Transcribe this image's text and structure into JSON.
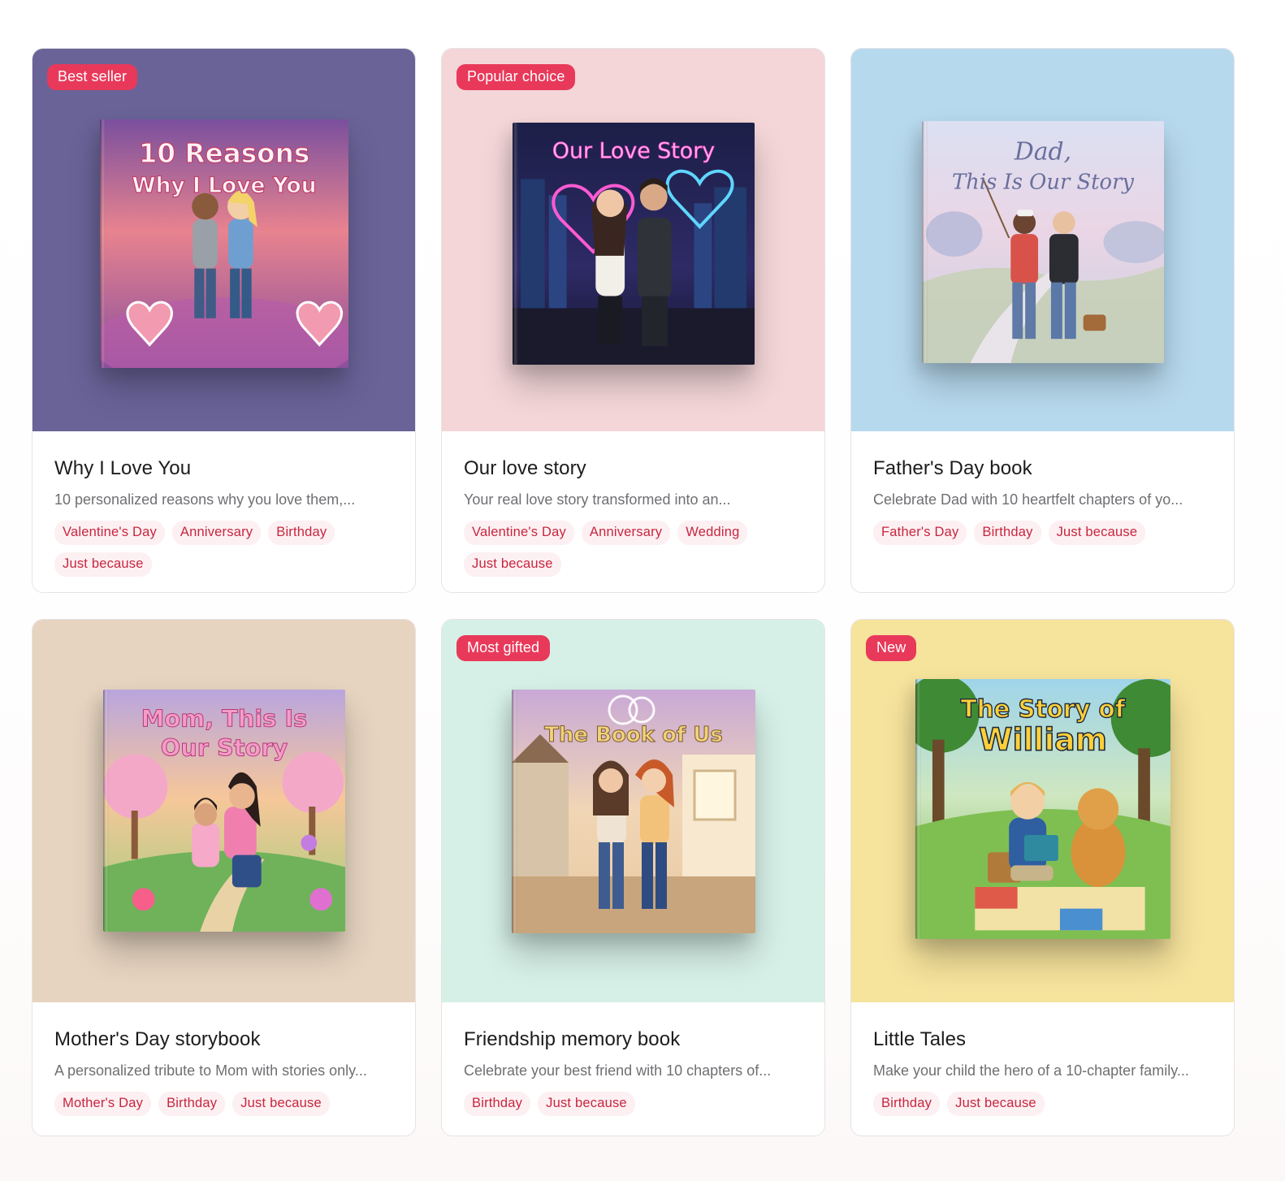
{
  "products": [
    {
      "badge": "Best seller",
      "bg": "#6a6398",
      "cover": {
        "title_line1": "10 Reasons",
        "title_line2": "Why I Love You"
      },
      "title": "Why I Love You",
      "description": "10 personalized reasons why you love them,...",
      "tags": [
        "Valentine's Day",
        "Anniversary",
        "Birthday",
        "Just because"
      ]
    },
    {
      "badge": "Popular choice",
      "bg": "#f4d6d8",
      "cover": {
        "title_line1": "Our Love Story",
        "title_line2": ""
      },
      "title": "Our love story",
      "description": "Your real love story transformed into an...",
      "tags": [
        "Valentine's Day",
        "Anniversary",
        "Wedding",
        "Just because"
      ]
    },
    {
      "badge": "",
      "bg": "#b7d9ee",
      "cover": {
        "title_line1": "Dad,",
        "title_line2": "This Is Our Story"
      },
      "title": "Father's Day book",
      "description": "Celebrate Dad with 10 heartfelt chapters of yo...",
      "tags": [
        "Father's Day",
        "Birthday",
        "Just because"
      ]
    },
    {
      "badge": "",
      "bg": "#e6d4c0",
      "cover": {
        "title_line1": "Mom, This Is",
        "title_line2": "Our Story"
      },
      "title": "Mother's Day storybook",
      "description": "A personalized tribute to Mom with stories only...",
      "tags": [
        "Mother's Day",
        "Birthday",
        "Just because"
      ]
    },
    {
      "badge": "Most gifted",
      "bg": "#d6f0e7",
      "cover": {
        "title_line1": "The Book of Us",
        "title_line2": ""
      },
      "title": "Friendship memory book",
      "description": "Celebrate your best friend with 10 chapters of...",
      "tags": [
        "Birthday",
        "Just because"
      ]
    },
    {
      "badge": "New",
      "bg": "#f6e39c",
      "cover": {
        "title_line1": "The Story of",
        "title_line2": "William"
      },
      "title": "Little Tales",
      "description": "Make your child the hero of a 10-chapter family...",
      "tags": [
        "Birthday",
        "Just because"
      ]
    }
  ]
}
